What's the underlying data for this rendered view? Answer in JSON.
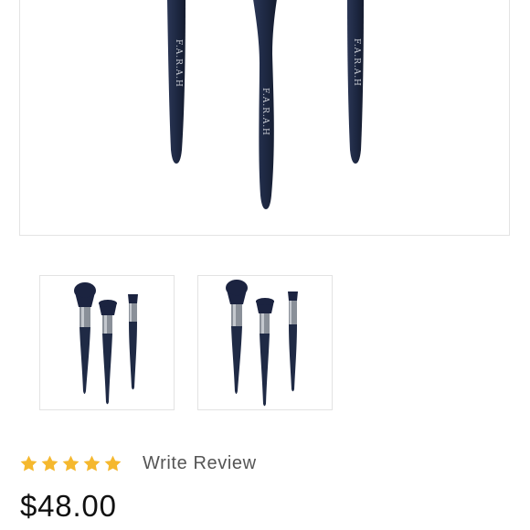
{
  "product": {
    "brand_mark": "F.A.R.A.H",
    "rating_stars": 5,
    "rating_max": 5,
    "write_review_label": "Write Review",
    "price": "$48.00"
  },
  "colors": {
    "handle": "#1f2a45",
    "ferrule": "#7d838c",
    "star": "#f5b82e",
    "text_muted": "#555555",
    "price_text": "#111111"
  },
  "gallery": {
    "thumbnails": [
      {
        "icon": "brush-set-thumbnail"
      },
      {
        "icon": "brush-set-thumbnail"
      }
    ]
  }
}
